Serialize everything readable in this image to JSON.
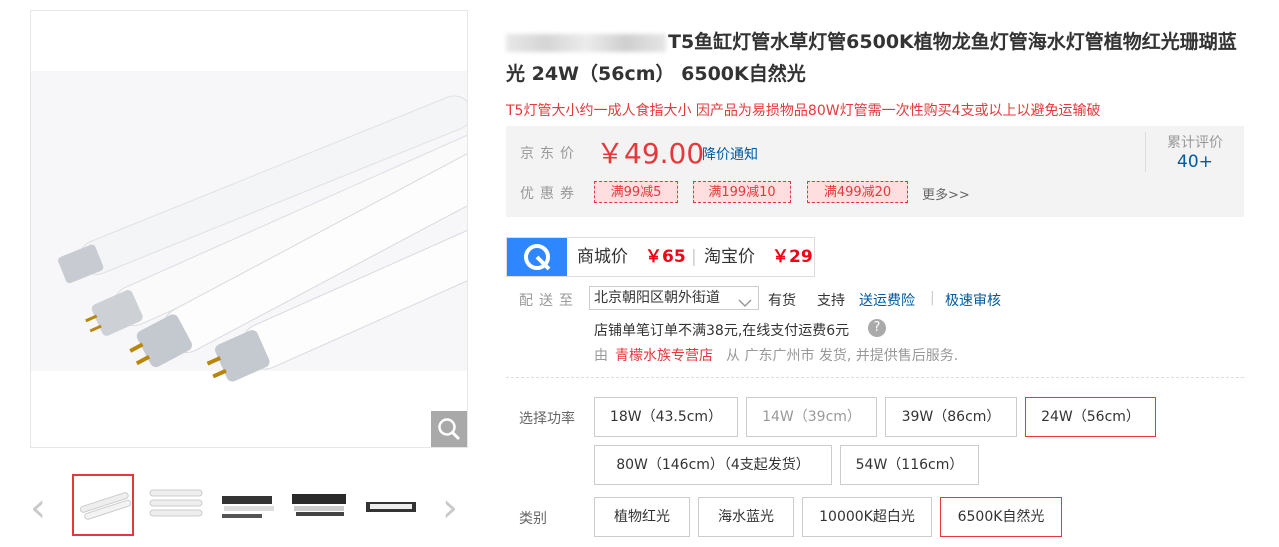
{
  "product": {
    "title": "T5鱼缸灯管水草灯管6500K植物龙鱼灯管海水灯管植物红光珊瑚蓝光 24W（56cm） 6500K自然光",
    "promo_text": "T5灯管大小约一成人食指大小 因产品为易损物品80W灯管需一次性购买4支或以上以避免运输破"
  },
  "price": {
    "label": "京东价",
    "value": "￥49.00",
    "notify": "降价通知",
    "coupon_label": "优惠券",
    "coupons": [
      "满99减5",
      "满199减10",
      "满499减20"
    ],
    "more": "更多>>",
    "review_label": "累计评价",
    "review_count": "40+"
  },
  "compare": {
    "mall_label": "商城价",
    "mall_price": "￥65",
    "taobao_label": "淘宝价",
    "taobao_price": "￥29"
  },
  "delivery": {
    "label": "配送至",
    "address": "北京朝阳区朝外街道",
    "stock": "有货",
    "support": "支持",
    "insurance": "送运费险",
    "separator": "|",
    "fast_refund": "极速审核",
    "fee_note": "店铺单笔订单不满38元,在线支付运费6元",
    "from_prefix": "由",
    "store": "青檬水族专营店",
    "from_suffix": "从 广东广州市 发货, 并提供售后服务."
  },
  "options": {
    "power_label": "选择功率",
    "power": [
      {
        "label": "18W（43.5cm）",
        "state": "normal"
      },
      {
        "label": "14W（39cm）",
        "state": "disabled"
      },
      {
        "label": "39W（86cm）",
        "state": "normal"
      },
      {
        "label": "24W（56cm）",
        "state": "selected"
      },
      {
        "label": "80W（146cm）（4支起发货）",
        "state": "normal"
      },
      {
        "label": "54W（116cm）",
        "state": "normal"
      }
    ],
    "type_label": "类别",
    "types": [
      {
        "label": "植物红光",
        "state": "normal"
      },
      {
        "label": "海水蓝光",
        "state": "normal"
      },
      {
        "label": "10000K超白光",
        "state": "normal"
      },
      {
        "label": "6500K自然光",
        "state": "selected"
      }
    ]
  },
  "icons": {
    "zoom": "magnifier-icon",
    "prev": "chevron-left-icon",
    "next": "chevron-right-icon",
    "help": "question-icon",
    "dropdown": "chevron-down-icon"
  },
  "colors": {
    "accent": "#e4393c",
    "link": "#005aa0",
    "compare_blue": "#2f87ff"
  }
}
